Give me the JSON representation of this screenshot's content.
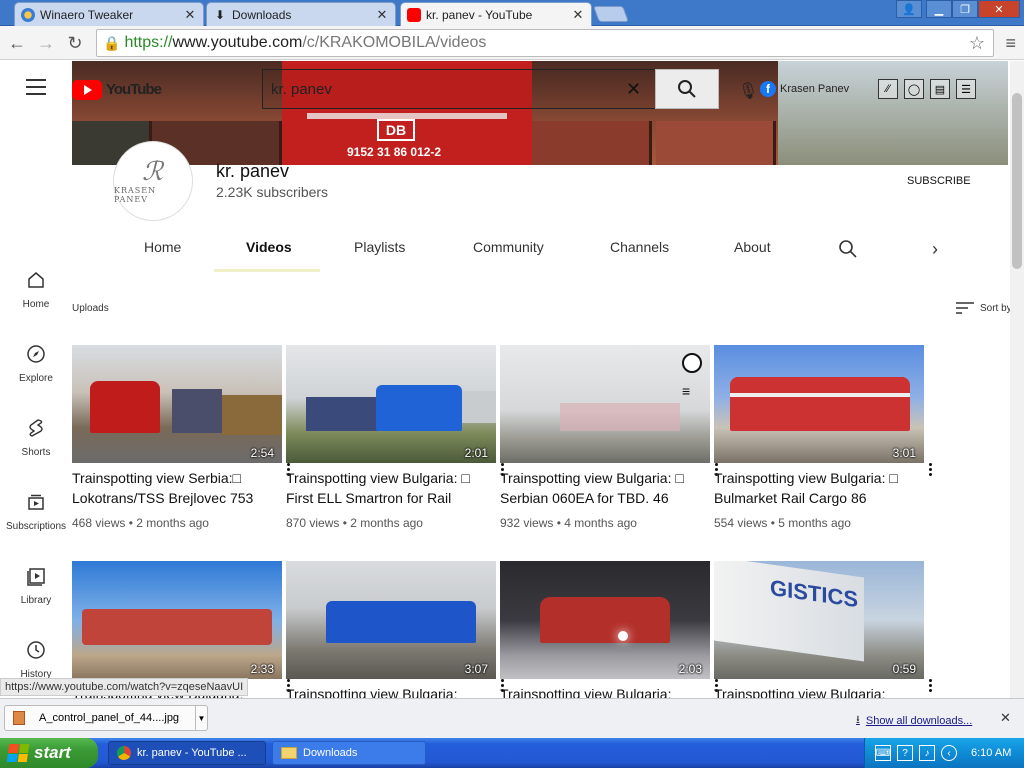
{
  "browser": {
    "tabs": [
      {
        "label": "Winaero Tweaker",
        "icon": "winaero-icon"
      },
      {
        "label": "Downloads",
        "icon": "download-icon"
      },
      {
        "label": "kr. panev - YouTube",
        "icon": "youtube-icon"
      }
    ],
    "url": {
      "proto": "https://",
      "host": "www.youtube.com",
      "path": "/c/KRAKOMOBILA/videos"
    }
  },
  "youtube": {
    "search_value": "kr. panev",
    "logo_text": "YouTube",
    "header_link": "Krasen Panev",
    "banner_code": "DB",
    "banner_number": "9152 31 86 012-2"
  },
  "channel": {
    "name": "kr. panev",
    "subscribers": "2.23K subscribers",
    "subscribe_label": "SUBSCRIBE",
    "avatar_text": "KRASEN PANEV",
    "tabs": [
      "Home",
      "Videos",
      "Playlists",
      "Community",
      "Channels",
      "About"
    ],
    "active_tab": "Videos"
  },
  "leftnav": [
    "Home",
    "Explore",
    "Shorts",
    "Subscriptions",
    "Library",
    "History"
  ],
  "section": {
    "uploads": "Uploads",
    "sort_by": "Sort by"
  },
  "videos": [
    {
      "title": "Trainspotting view Serbia:□ Lokotrans/TSS Brejlovec 753",
      "views": "468 views",
      "age": "2 months ago",
      "duration": "2:54",
      "thumb": "red-blue-locos"
    },
    {
      "title": "Trainspotting view Bulgaria: □ First ELL Smartron for Rail",
      "views": "870 views",
      "age": "2 months ago",
      "duration": "2:01",
      "thumb": "blue-loco"
    },
    {
      "title": "Trainspotting view Bulgaria: □ Serbian 060EA for TBD. 46",
      "views": "932 views",
      "age": "4 months ago",
      "duration": "",
      "thumb": "grey-sky"
    },
    {
      "title": "Trainspotting view Bulgaria: □ Bulmarket Rail Cargo 86",
      "views": "554 views",
      "age": "5 months ago",
      "duration": "3:01",
      "thumb": "red-loco"
    },
    {
      "title": "Trainspotting view Bulgaria:",
      "views": "",
      "age": "",
      "duration": "2:33",
      "thumb": "red-loco-sky"
    },
    {
      "title": "Trainspotting view Bulgaria:",
      "views": "",
      "age": "",
      "duration": "3:07",
      "thumb": "blue-locos"
    },
    {
      "title": "Trainspotting view Bulgaria:",
      "views": "",
      "age": "",
      "duration": "2:03",
      "thumb": "night-train"
    },
    {
      "title": "Trainspotting view Bulgaria:",
      "views": "",
      "age": "",
      "duration": "0:59",
      "thumb": "logistics-wagon"
    }
  ],
  "status_url": "https://www.youtube.com/watch?v=zqeseNaavUI",
  "downloads": {
    "file": "A_control_panel_of_44....jpg",
    "show_all": "Show all downloads..."
  },
  "taskbar": {
    "start": "start",
    "items": [
      "kr. panev - YouTube ...",
      "Downloads"
    ],
    "clock": "6:10 AM"
  },
  "colors": {
    "youtube_red": "#ff0000",
    "taskbar_blue": "#245edb",
    "start_green": "#3a9a34"
  }
}
